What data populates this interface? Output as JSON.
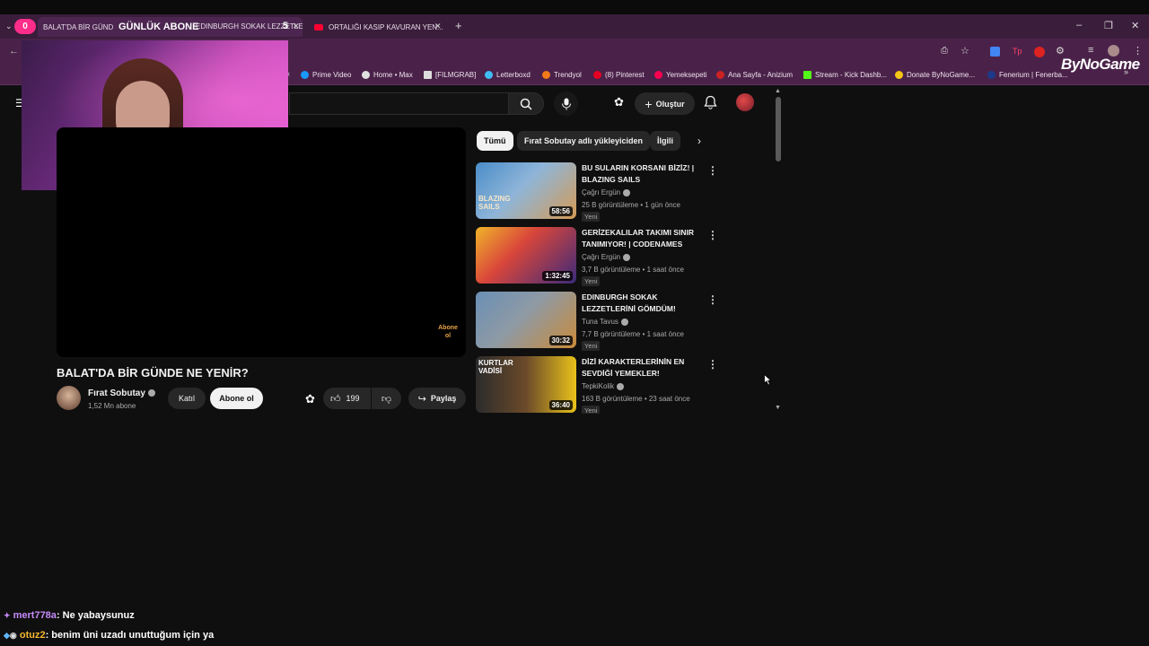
{
  "tabs": [
    {
      "title": "BALAT'DA BİR GÜNDE NE YENİR?",
      "overlay_title": "GÜNLÜK ABONE",
      "tab2": "EDINBURGH SOKAK LEZZETLE",
      "overlay_count": "5",
      "counter": "0"
    },
    {
      "title": "ORTALIĞI KASIP KAVURAN YEN..."
    }
  ],
  "new_tab": "+",
  "bookmarks": [
    {
      "label": "Prime Video",
      "color": "#1a98ff"
    },
    {
      "label": "Home • Max",
      "color": "#e0e0e0"
    },
    {
      "label": "[FILMGRAB]",
      "color": "#dddddd"
    },
    {
      "label": "Letterboxd",
      "color": "#40bcf4"
    },
    {
      "label": "Trendyol",
      "color": "#f27a1a"
    },
    {
      "label": "(8) Pinterest",
      "color": "#e60023"
    },
    {
      "label": "Yemeksepeti",
      "color": "#fa0050"
    },
    {
      "label": "Ana Sayfa - Anizium",
      "color": "#cc2222"
    },
    {
      "label": "Stream - Kick Dashb...",
      "color": "#53fc18"
    },
    {
      "label": "Donate ByNoGame...",
      "color": "#f5c518"
    },
    {
      "label": "Fenerium | Fenerba...",
      "color": "#1d3a8a"
    }
  ],
  "bynogame_logo": "ByNoGame",
  "header": {
    "create_label": "Oluştur"
  },
  "video": {
    "title": "BALAT'DA BİR GÜNDE NE YENİR?",
    "channel": "Fırat Sobutay",
    "subscribers": "1,52 Mn abone",
    "join_label": "Katıl",
    "subscribe_label": "Abone ol",
    "likes": "199",
    "share_label": "Paylaş",
    "watermark": "Abone ol"
  },
  "chips": [
    "Tümü",
    "Fırat Sobutay adlı yükleyiciden",
    "İlgili"
  ],
  "recommendations": [
    {
      "title": "BU SULARIN KORSANI BİZİZ! | BLAZING SAILS",
      "channel": "Çağrı Ergün",
      "meta": "25 B görüntüleme • 1 gün önce",
      "badge": "Yeni",
      "duration": "58:56",
      "thumb_colors": [
        "#4a8ec9",
        "#d49a55"
      ],
      "thumb_text": "BLAZING SAILS"
    },
    {
      "title": "GERİZEKALILAR TAKIMI SINIR TANIMIYOR! | CODENAMES",
      "channel": "Çağrı Ergün",
      "meta": "3,7 B görüntüleme • 1 saat önce",
      "badge": "Yeni",
      "duration": "1:32:45",
      "thumb_colors": [
        "#f0b429",
        "#3b2a7a"
      ],
      "thumb_text": ""
    },
    {
      "title": "EDINBURGH SOKAK LEZZETLERİNİ GÖMDÜM!",
      "channel": "Tuna Tavus",
      "meta": "7,7 B görüntüleme • 1 saat önce",
      "badge": "Yeni",
      "duration": "30:32",
      "thumb_colors": [
        "#6a8fb5",
        "#c98a3a"
      ],
      "thumb_text": ""
    },
    {
      "title": "DİZİ KARAKTERLERİNİN EN SEVDİĞİ YEMEKLER!",
      "channel": "TepkiKolik",
      "meta": "163 B görüntüleme • 23 saat önce",
      "badge": "Yeni",
      "duration": "36:40",
      "thumb_colors": [
        "#2b2b2b",
        "#e8c21a"
      ],
      "thumb_text": "KURTLAR VADİSİ"
    }
  ],
  "chat": [
    {
      "user": "mert778a",
      "message": ": Ne yabaysunuz",
      "color": "#c58af9"
    },
    {
      "user": "otuz2",
      "message": ": benim üni uzadı unuttuğum için ya",
      "color": "#f7b731"
    }
  ]
}
